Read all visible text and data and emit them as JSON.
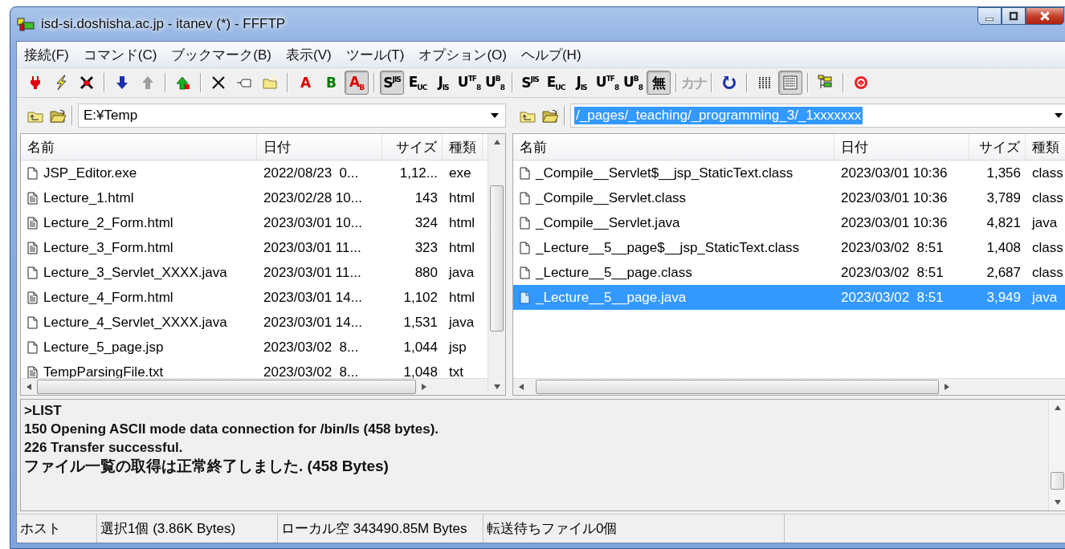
{
  "window": {
    "title": "isd-si.doshisha.ac.jp - itanev (*) - FFFTP"
  },
  "menu": [
    "接続(F)",
    "コマンド(C)",
    "ブックマーク(B)",
    "表示(V)",
    "ツール(T)",
    "オプション(O)",
    "ヘルプ(H)"
  ],
  "toolbar": {
    "groups": [
      [
        {
          "kind": "icon",
          "pressed": false,
          "disabled": false
        },
        {
          "kind": "icon",
          "pressed": false,
          "disabled": false
        },
        {
          "kind": "icon",
          "pressed": false,
          "disabled": false
        }
      ],
      [
        {
          "kind": "icon",
          "pressed": false,
          "disabled": false
        },
        {
          "kind": "icon",
          "pressed": false,
          "disabled": true
        }
      ],
      [
        {
          "kind": "icon",
          "pressed": false,
          "disabled": false
        }
      ],
      [
        {
          "kind": "icon",
          "pressed": false,
          "disabled": false
        },
        {
          "kind": "icon",
          "pressed": false,
          "disabled": false
        },
        {
          "kind": "icon",
          "pressed": false,
          "disabled": false
        }
      ],
      [
        {
          "kind": "text",
          "label": "A",
          "color": "#d80000",
          "pressed": false,
          "disabled": false
        },
        {
          "kind": "text",
          "label": "B",
          "color": "#007a00",
          "pressed": false,
          "disabled": false
        },
        {
          "kind": "text",
          "label": "A$_{B}$",
          "color": "#d80000",
          "pressed": true,
          "disabled": false
        }
      ],
      [
        {
          "kind": "text",
          "label": "S$^{JIS}$",
          "color": "#000000",
          "pressed": true,
          "disabled": false
        },
        {
          "kind": "text",
          "label": "E$_{UC}$",
          "color": "#000000",
          "pressed": false,
          "disabled": false
        },
        {
          "kind": "text",
          "label": "J$_{IS}$",
          "color": "#000000",
          "pressed": false,
          "disabled": false
        },
        {
          "kind": "text",
          "label": "U$^{TF}$$_{8}$",
          "color": "#000000",
          "pressed": false,
          "disabled": false
        },
        {
          "kind": "text",
          "label": "U$^{B}$$_{8}$",
          "color": "#000000",
          "pressed": false,
          "disabled": false
        }
      ],
      [
        {
          "kind": "text",
          "label": "S$^{JIS}$",
          "color": "#000000",
          "pressed": false,
          "disabled": false
        },
        {
          "kind": "text",
          "label": "E$_{UC}$",
          "color": "#000000",
          "pressed": false,
          "disabled": false
        },
        {
          "kind": "text",
          "label": "J$_{IS}$",
          "color": "#000000",
          "pressed": false,
          "disabled": false
        },
        {
          "kind": "text",
          "label": "U$^{TF}$$_{8}$",
          "color": "#000000",
          "pressed": false,
          "disabled": false
        },
        {
          "kind": "text",
          "label": "U$^{B}$$_{8}$",
          "color": "#000000",
          "pressed": false,
          "disabled": false
        },
        {
          "kind": "text",
          "label": "無",
          "color": "#000000",
          "pressed": true,
          "disabled": false
        }
      ],
      [
        {
          "kind": "text",
          "label": "カナ",
          "pressed": false,
          "disabled": true
        }
      ],
      [
        {
          "kind": "icon",
          "pressed": false,
          "disabled": false
        }
      ],
      [
        {
          "kind": "icon",
          "pressed": false,
          "disabled": false
        },
        {
          "kind": "icon",
          "pressed": true,
          "disabled": false
        }
      ],
      [
        {
          "kind": "icon",
          "pressed": false,
          "disabled": false
        }
      ],
      [
        {
          "kind": "icon",
          "pressed": false,
          "disabled": false
        }
      ]
    ]
  },
  "local": {
    "path": {
      "value": "E:¥Temp",
      "text_selected": false
    },
    "columns": [
      "名前",
      "日付",
      "サイズ",
      "種類"
    ],
    "rows": [
      {
        "kind": "file",
        "name": "JSP_Editor.exe",
        "date": "2022/08/23  0...",
        "size": "1,12...",
        "type": "exe",
        "selected": false
      },
      {
        "kind": "textfile",
        "name": "Lecture_1.html",
        "date": "2023/02/28 10...",
        "size": "143",
        "type": "html",
        "selected": false
      },
      {
        "kind": "textfile",
        "name": "Lecture_2_Form.html",
        "date": "2023/03/01 10...",
        "size": "324",
        "type": "html",
        "selected": false
      },
      {
        "kind": "textfile",
        "name": "Lecture_3_Form.html",
        "date": "2023/03/01 11...",
        "size": "323",
        "type": "html",
        "selected": false
      },
      {
        "kind": "file",
        "name": "Lecture_3_Servlet_XXXX.java",
        "date": "2023/03/01 11...",
        "size": "880",
        "type": "java",
        "selected": false
      },
      {
        "kind": "textfile",
        "name": "Lecture_4_Form.html",
        "date": "2023/03/01 14...",
        "size": "1,102",
        "type": "html",
        "selected": false
      },
      {
        "kind": "file",
        "name": "Lecture_4_Servlet_XXXX.java",
        "date": "2023/03/01 14...",
        "size": "1,531",
        "type": "java",
        "selected": false
      },
      {
        "kind": "file",
        "name": "Lecture_5_page.jsp",
        "date": "2023/03/02  8...",
        "size": "1,044",
        "type": "jsp",
        "selected": false
      },
      {
        "kind": "textfile",
        "name": "TempParsingFile.txt",
        "date": "2023/03/02  8...",
        "size": "1,048",
        "type": "txt",
        "selected": false
      }
    ]
  },
  "remote": {
    "path": {
      "value": "/_pages/_teaching/_programming_3/_1xxxxxxx",
      "text_selected": true
    },
    "columns": [
      "名前",
      "日付",
      "サイズ",
      "種類"
    ],
    "rows": [
      {
        "kind": "file",
        "name": "_Compile__Servlet$__jsp_StaticText.class",
        "date": "2023/03/01 10:36",
        "size": "1,356",
        "type": "class",
        "selected": false
      },
      {
        "kind": "file",
        "name": "_Compile__Servlet.class",
        "date": "2023/03/01 10:36",
        "size": "3,789",
        "type": "class",
        "selected": false
      },
      {
        "kind": "file",
        "name": "_Compile__Servlet.java",
        "date": "2023/03/01 10:36",
        "size": "4,821",
        "type": "java",
        "selected": false
      },
      {
        "kind": "file",
        "name": "_Lecture__5__page$__jsp_StaticText.class",
        "date": "2023/03/02  8:51",
        "size": "1,408",
        "type": "class",
        "selected": false
      },
      {
        "kind": "file",
        "name": "_Lecture__5__page.class",
        "date": "2023/03/02  8:51",
        "size": "2,687",
        "type": "class",
        "selected": false
      },
      {
        "kind": "file",
        "name": "_Lecture__5__page.java",
        "date": "2023/03/02  8:51",
        "size": "3,949",
        "type": "java",
        "selected": true
      }
    ]
  },
  "log": [
    {
      "kind": "command",
      "text": ">LIST"
    },
    {
      "kind": "command",
      "text": "150 Opening ASCII mode data connection for /bin/ls (458 bytes)."
    },
    {
      "kind": "command",
      "text": "226 Transfer successful."
    },
    {
      "kind": "message",
      "text": "ファイル一覧の取得は正常終了しました. (458 Bytes)"
    }
  ],
  "status_bar": [
    "ホスト",
    "選択1個 (3.86K Bytes)",
    "ローカル空 343490.85M Bytes",
    "転送待ちファイル0個"
  ]
}
